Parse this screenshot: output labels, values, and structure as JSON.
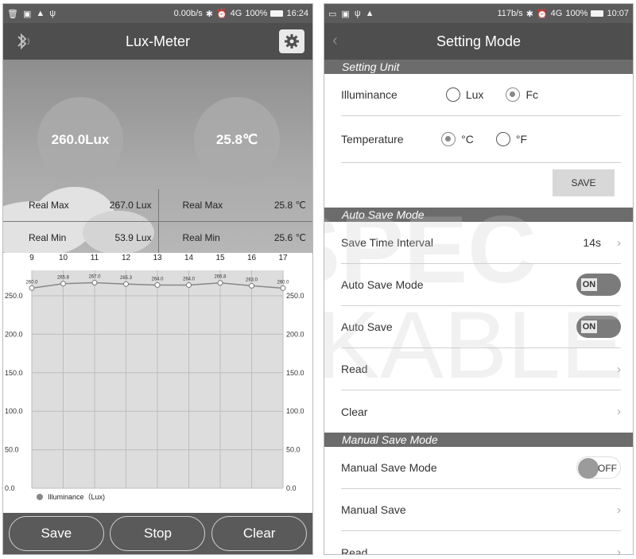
{
  "left": {
    "status": {
      "net": "0.00b/s",
      "battery": "100%",
      "time": "16:24",
      "signal": "4G"
    },
    "appbar": {
      "title": "Lux-Meter"
    },
    "circles": {
      "lux": "260.0Lux",
      "temp": "25.8℃"
    },
    "stats": {
      "max_label": "Real Max",
      "max_lux": "267.0 Lux",
      "max_temp": "25.8 ℃",
      "min_label": "Real Min",
      "min_lux": "53.9 Lux",
      "min_temp": "25.6 ℃"
    },
    "buttons": {
      "save": "Save",
      "stop": "Stop",
      "clear": "Clear"
    }
  },
  "chart_data": {
    "type": "line",
    "categories": [
      "9",
      "10",
      "11",
      "12",
      "13",
      "14",
      "15",
      "16",
      "17"
    ],
    "series": [
      {
        "name": "Illuminance（Lux)",
        "values": [
          260.0,
          265.8,
          267.0,
          265.3,
          264.0,
          264.0,
          266.8,
          263.0,
          260.0
        ]
      }
    ],
    "point_labels": [
      "260.0",
      "265.8",
      "267.0",
      "265.3",
      "264.0",
      "264.0",
      "266.8",
      "263.0",
      "260.0"
    ],
    "ylim": [
      0,
      250
    ],
    "y_ticks": [
      "0.0",
      "50.0",
      "100.0",
      "150.0",
      "200.0",
      "250.0"
    ],
    "grid": true,
    "legend": "bottom-left",
    "colors": {
      "line": "#888888",
      "fill": "#dddddd",
      "grid": "#bdbdbd"
    }
  },
  "right": {
    "status": {
      "net": "117b/s",
      "battery": "100%",
      "time": "10:07",
      "signal": "4G"
    },
    "appbar": {
      "title": "Setting Mode"
    },
    "setting_unit": {
      "header": "Setting Unit",
      "illuminance_label": "Illuminance",
      "lux_option": "Lux",
      "fc_option": "Fc",
      "temperature_label": "Temperature",
      "c_option": "°C",
      "f_option": "°F",
      "save_label": "SAVE"
    },
    "auto_save": {
      "header": "Auto Save Mode",
      "interval_label": "Save Time Interval",
      "interval_value": "14s",
      "mode_label": "Auto Save Mode",
      "mode_state": "ON",
      "auto_save_label": "Auto Save",
      "auto_save_state": "ON",
      "read_label": "Read",
      "clear_label": "Clear"
    },
    "manual_save": {
      "header": "Manual Save Mode",
      "mode_label": "Manual Save Mode",
      "mode_state": "OFF",
      "manual_label": "Manual Save",
      "read_label": "Read"
    }
  },
  "watermark": {
    "line1": "SPEC",
    "line2": "KABLE"
  }
}
